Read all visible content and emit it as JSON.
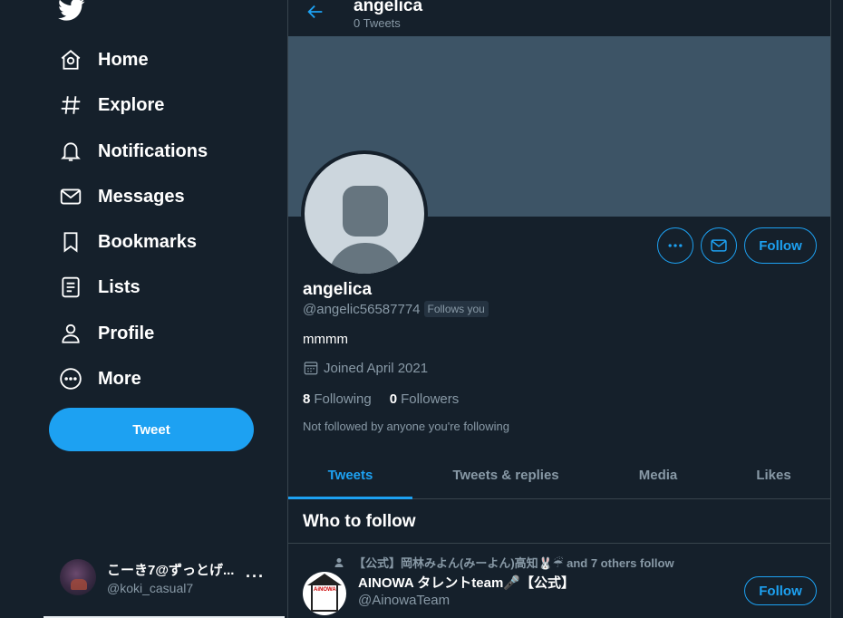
{
  "colors": {
    "background": "#15202b",
    "accent": "#1da1f2",
    "border": "#38444d",
    "muted": "#8899a6",
    "banner": "#3d5466"
  },
  "sidebar": {
    "logo_icon": "twitter-bird-icon",
    "items": [
      {
        "label": "Home",
        "icon": "home-icon"
      },
      {
        "label": "Explore",
        "icon": "hashtag-icon"
      },
      {
        "label": "Notifications",
        "icon": "bell-icon"
      },
      {
        "label": "Messages",
        "icon": "envelope-icon"
      },
      {
        "label": "Bookmarks",
        "icon": "bookmark-icon"
      },
      {
        "label": "Lists",
        "icon": "list-icon"
      },
      {
        "label": "Profile",
        "icon": "person-icon"
      },
      {
        "label": "More",
        "icon": "more-circle-icon"
      }
    ],
    "tweet_button": "Tweet",
    "account": {
      "name": "こーき7@ずっとげ...",
      "handle": "@koki_casual7",
      "more": "···"
    }
  },
  "header": {
    "name": "angelica",
    "tweet_count": "0 Tweets"
  },
  "profile": {
    "name": "angelica",
    "handle": "@angelic56587774",
    "follows_you": "Follows you",
    "bio": "mmmm",
    "joined": "Joined April 2021",
    "following_count": "8",
    "following_label": "Following",
    "followers_count": "0",
    "followers_label": "Followers",
    "not_followed": "Not followed by anyone you're following",
    "follow_button": "Follow"
  },
  "tabs": [
    "Tweets",
    "Tweets & replies",
    "Media",
    "Likes"
  ],
  "active_tab": "Tweets",
  "who_to_follow": {
    "title": "Who to follow",
    "context": "【公式】岡林みよん(みーよん)高知🐰☔ and 7 others follow",
    "name": "AINOWA タレントteam🎤【公式】",
    "handle": "@AinowaTeam",
    "avatar_text": "AiNOWA",
    "follow_button": "Follow"
  }
}
